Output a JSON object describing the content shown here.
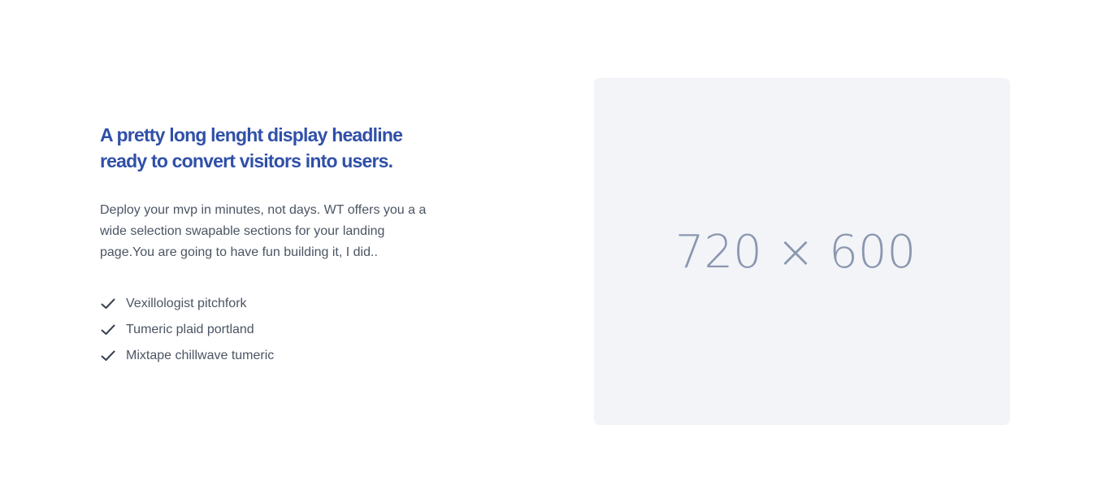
{
  "hero": {
    "headline_line1": "A pretty long lenght display headline",
    "headline_line2": "ready to convert visitors into users.",
    "body_line1": "Deploy your mvp in minutes, not days. WT offers you a a",
    "body_line2": "wide selection swapable sections for your landing",
    "body_line3": "page.You are going to have fun building it, I did..",
    "features": [
      {
        "icon": "check-icon",
        "label": "Vexillologist pitchfork"
      },
      {
        "icon": "check-icon",
        "label": "Tumeric plaid portland"
      },
      {
        "icon": "check-icon",
        "label": "Mixtape chillwave tumeric"
      }
    ],
    "image_placeholder_text": "720 × 600"
  },
  "colors": {
    "headline": "#3050a8",
    "body_text": "#4b5563",
    "placeholder_bg": "#f3f4f7",
    "placeholder_text": "#8a97b0",
    "check": "#374151"
  }
}
